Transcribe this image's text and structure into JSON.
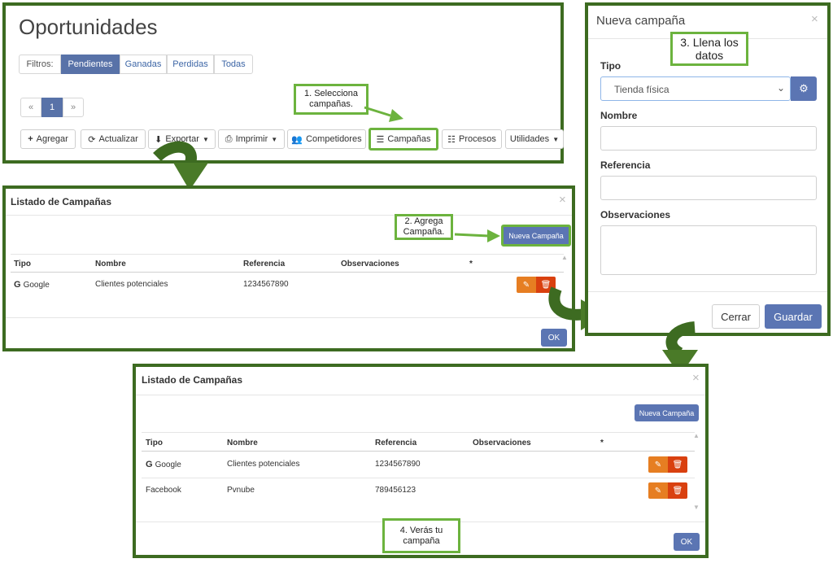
{
  "panel1": {
    "title": "Oportunidades",
    "filters": {
      "label": "Filtros:",
      "options": [
        "Pendientes",
        "Ganadas",
        "Perdidas",
        "Todas"
      ]
    },
    "pagination": {
      "prev": "«",
      "page": "1",
      "next": "»"
    },
    "toolbar": [
      "Agregar",
      "Actualizar",
      "Exportar",
      "Imprimir",
      "Competidores",
      "Campañas",
      "Procesos",
      "Utilidades"
    ],
    "callout": "1. Selecciona campañas."
  },
  "panel2": {
    "title": "Listado de Campañas",
    "new_button": "Nueva Campaña",
    "callout": "2. Agrega Campaña.",
    "columns": [
      "Tipo",
      "Nombre",
      "Referencia",
      "Observaciones",
      "*"
    ],
    "rows": [
      {
        "tipo": "Google",
        "nombre": "Clientes potenciales",
        "referencia": "1234567890",
        "observaciones": ""
      }
    ],
    "ok": "OK"
  },
  "panel3": {
    "title": "Nueva campaña",
    "callout": "3. Llena los datos",
    "tipo_label": "Tipo",
    "tipo_value": "Tienda física",
    "nombre_label": "Nombre",
    "referencia_label": "Referencia",
    "observaciones_label": "Observaciones",
    "cerrar": "Cerrar",
    "guardar": "Guardar"
  },
  "panel4": {
    "title": "Listado de Campañas",
    "new_button": "Nueva Campaña",
    "columns": [
      "Tipo",
      "Nombre",
      "Referencia",
      "Observaciones",
      "*"
    ],
    "rows": [
      {
        "tipo": "Google",
        "nombre": "Clientes potenciales",
        "referencia": "1234567890"
      },
      {
        "tipo": "Facebook",
        "nombre": "Pvnube",
        "referencia": "789456123"
      }
    ],
    "callout": "4. Verás tu campaña",
    "ok": "OK"
  },
  "colors": {
    "frame": "#3d6b21",
    "arrow": "#4a7a28",
    "callout_border": "#6cb33e",
    "primary": "#5b75b3"
  }
}
